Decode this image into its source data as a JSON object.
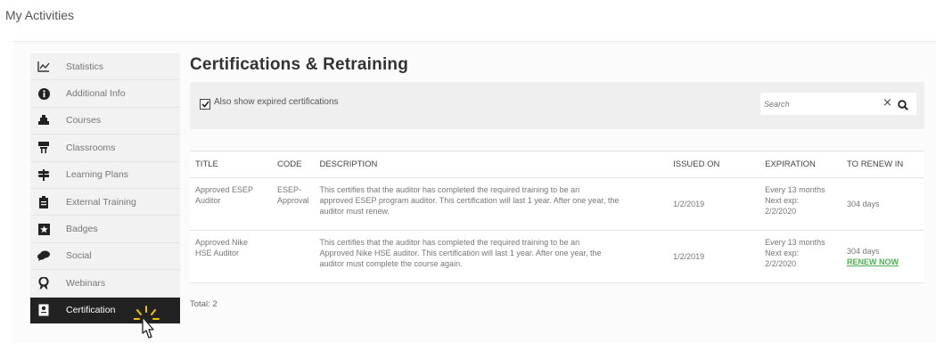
{
  "page": {
    "heading": "My Activities"
  },
  "sidebar": {
    "items": [
      {
        "label": "Statistics",
        "icon": "chart-icon",
        "active": false
      },
      {
        "label": "Additional Info",
        "icon": "info-icon",
        "active": false
      },
      {
        "label": "Courses",
        "icon": "courses-icon",
        "active": false
      },
      {
        "label": "Classrooms",
        "icon": "classroom-icon",
        "active": false
      },
      {
        "label": "Learning Plans",
        "icon": "signpost-icon",
        "active": false
      },
      {
        "label": "External Training",
        "icon": "clipboard-icon",
        "active": false
      },
      {
        "label": "Badges",
        "icon": "star-badge-icon",
        "active": false
      },
      {
        "label": "Social",
        "icon": "chat-bubbles-icon",
        "active": false
      },
      {
        "label": "Webinars",
        "icon": "ribbon-icon",
        "active": false
      },
      {
        "label": "Certification",
        "icon": "certificate-icon",
        "active": true
      }
    ]
  },
  "main": {
    "title": "Certifications & Retraining",
    "filter": {
      "show_expired_label": "Also show expired certifications",
      "show_expired_checked": true
    },
    "search": {
      "placeholder": "Search",
      "clear_glyph": "×"
    },
    "table": {
      "columns": [
        "TITLE",
        "CODE",
        "DESCRIPTION",
        "ISSUED ON",
        "EXPIRATION",
        "TO RENEW IN"
      ],
      "rows": [
        {
          "title": [
            "Approved ESEP",
            "Auditor"
          ],
          "code": [
            "ESEP-",
            "Approval"
          ],
          "description": [
            "This certifies that the auditor has completed the required training to be an",
            "approved ESEP program auditor. This certification will last 1 year.  After one year, the",
            "auditor must renew."
          ],
          "issued_on": "1/2/2019",
          "expiration": [
            "Every 13 months",
            "Next exp:",
            "2/2/2020"
          ],
          "renew_in": "304 days",
          "renew_link": ""
        },
        {
          "title": [
            "Approved Nike",
            "HSE Auditor"
          ],
          "code": [
            "",
            ""
          ],
          "description": [
            "This certifies that the auditor has completed the required training to be an",
            "Approved Nike HSE auditor. This certification will last 1 year.  After one year, the",
            "auditor must complete the course again."
          ],
          "issued_on": "1/2/2019",
          "expiration": [
            "Every 13 months",
            "Next exp:",
            "2/2/2020"
          ],
          "renew_in": "304 days",
          "renew_link": "RENEW NOW"
        }
      ]
    },
    "total": "Total: 2"
  },
  "colors": {
    "active_bg": "#222222",
    "renew_link": "#4caf50",
    "filter_bg": "#efefef"
  }
}
